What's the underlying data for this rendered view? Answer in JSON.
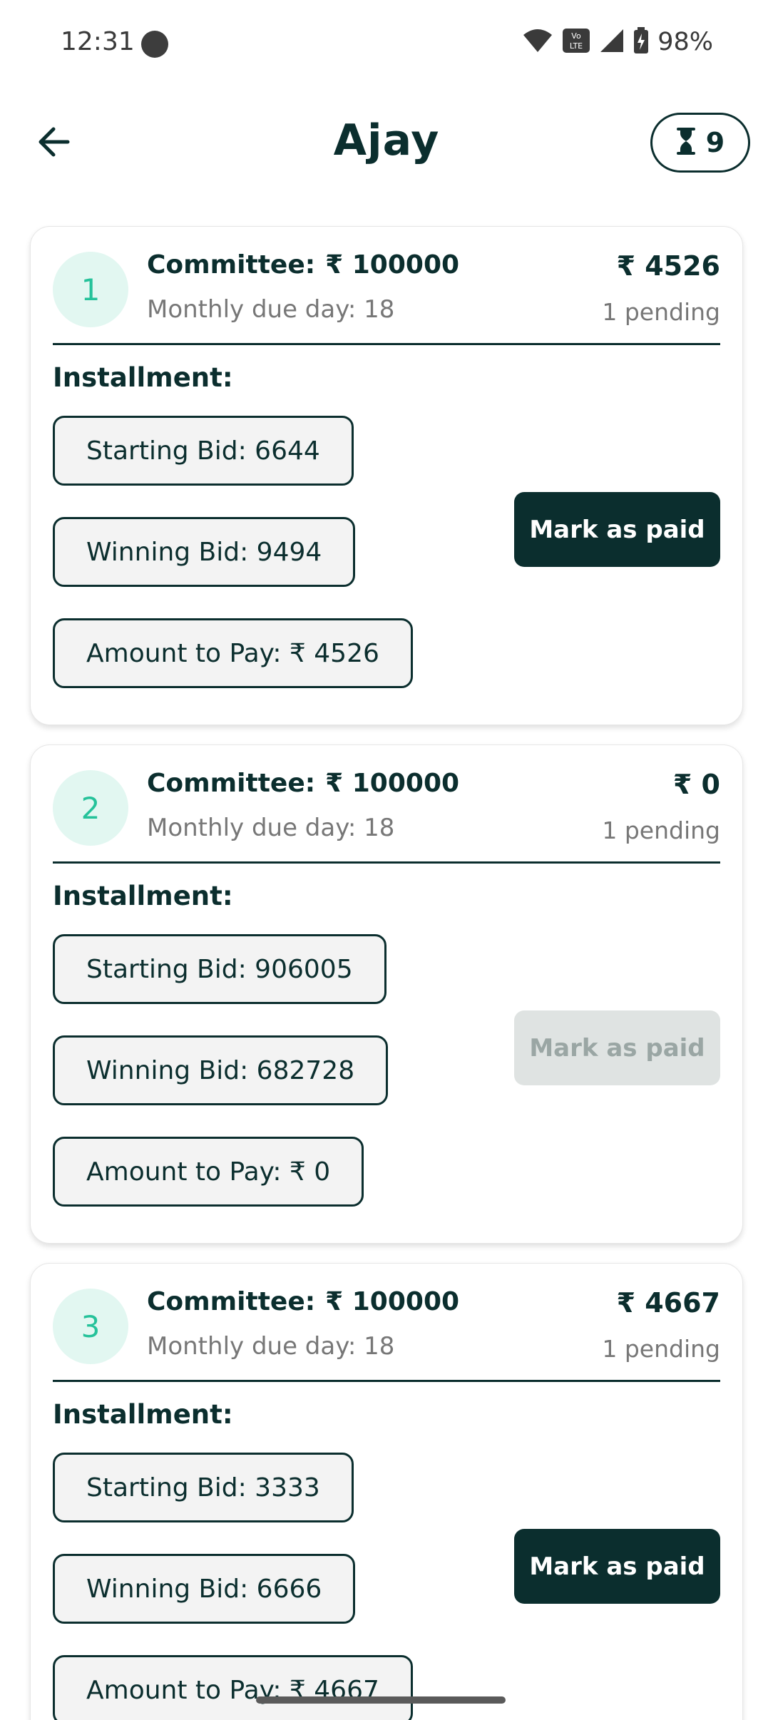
{
  "status_bar": {
    "time": "12:31",
    "battery": "98%",
    "network_label": "Vo LTE",
    "icons": [
      "wifi-icon",
      "volte-icon",
      "signal-icon",
      "battery-icon"
    ]
  },
  "header": {
    "title": "Ajay",
    "back_icon": "arrow-left-icon",
    "pending_icon": "hourglass-icon",
    "pending_count": "9"
  },
  "currency_symbol": "₹",
  "colors": {
    "primary": "#0b2e2e",
    "accent": "#25c29a",
    "accent_bg": "#e2f7f1",
    "disabled_bg": "#dfe3e2",
    "disabled_text": "#9aa6a4"
  },
  "cards": [
    {
      "index": "1",
      "title": "Committee:",
      "committee_amount": "₹ 100000",
      "due": "Monthly due day: 18",
      "amount": "₹ 4526",
      "pending": "1 pending",
      "installment_label": "Installment:",
      "starting_bid": "Starting Bid: 6644",
      "winning_bid": "Winning Bid: 9494",
      "amount_to_pay": "Amount to Pay: ₹ 4526",
      "button_label": "Mark as paid",
      "button_enabled": true
    },
    {
      "index": "2",
      "title": "Committee:",
      "committee_amount": "₹ 100000",
      "due": "Monthly due day: 18",
      "amount": "₹ 0",
      "pending": "1 pending",
      "installment_label": "Installment:",
      "starting_bid": "Starting Bid: 906005",
      "winning_bid": "Winning Bid: 682728",
      "amount_to_pay": "Amount to Pay: ₹ 0",
      "button_label": "Mark as paid",
      "button_enabled": false
    },
    {
      "index": "3",
      "title": "Committee:",
      "committee_amount": "₹ 100000",
      "due": "Monthly due day: 18",
      "amount": "₹ 4667",
      "pending": "1 pending",
      "installment_label": "Installment:",
      "starting_bid": "Starting Bid: 3333",
      "winning_bid": "Winning Bid: 6666",
      "amount_to_pay": "Amount to Pay: ₹ 4667",
      "button_label": "Mark as paid",
      "button_enabled": true
    }
  ]
}
